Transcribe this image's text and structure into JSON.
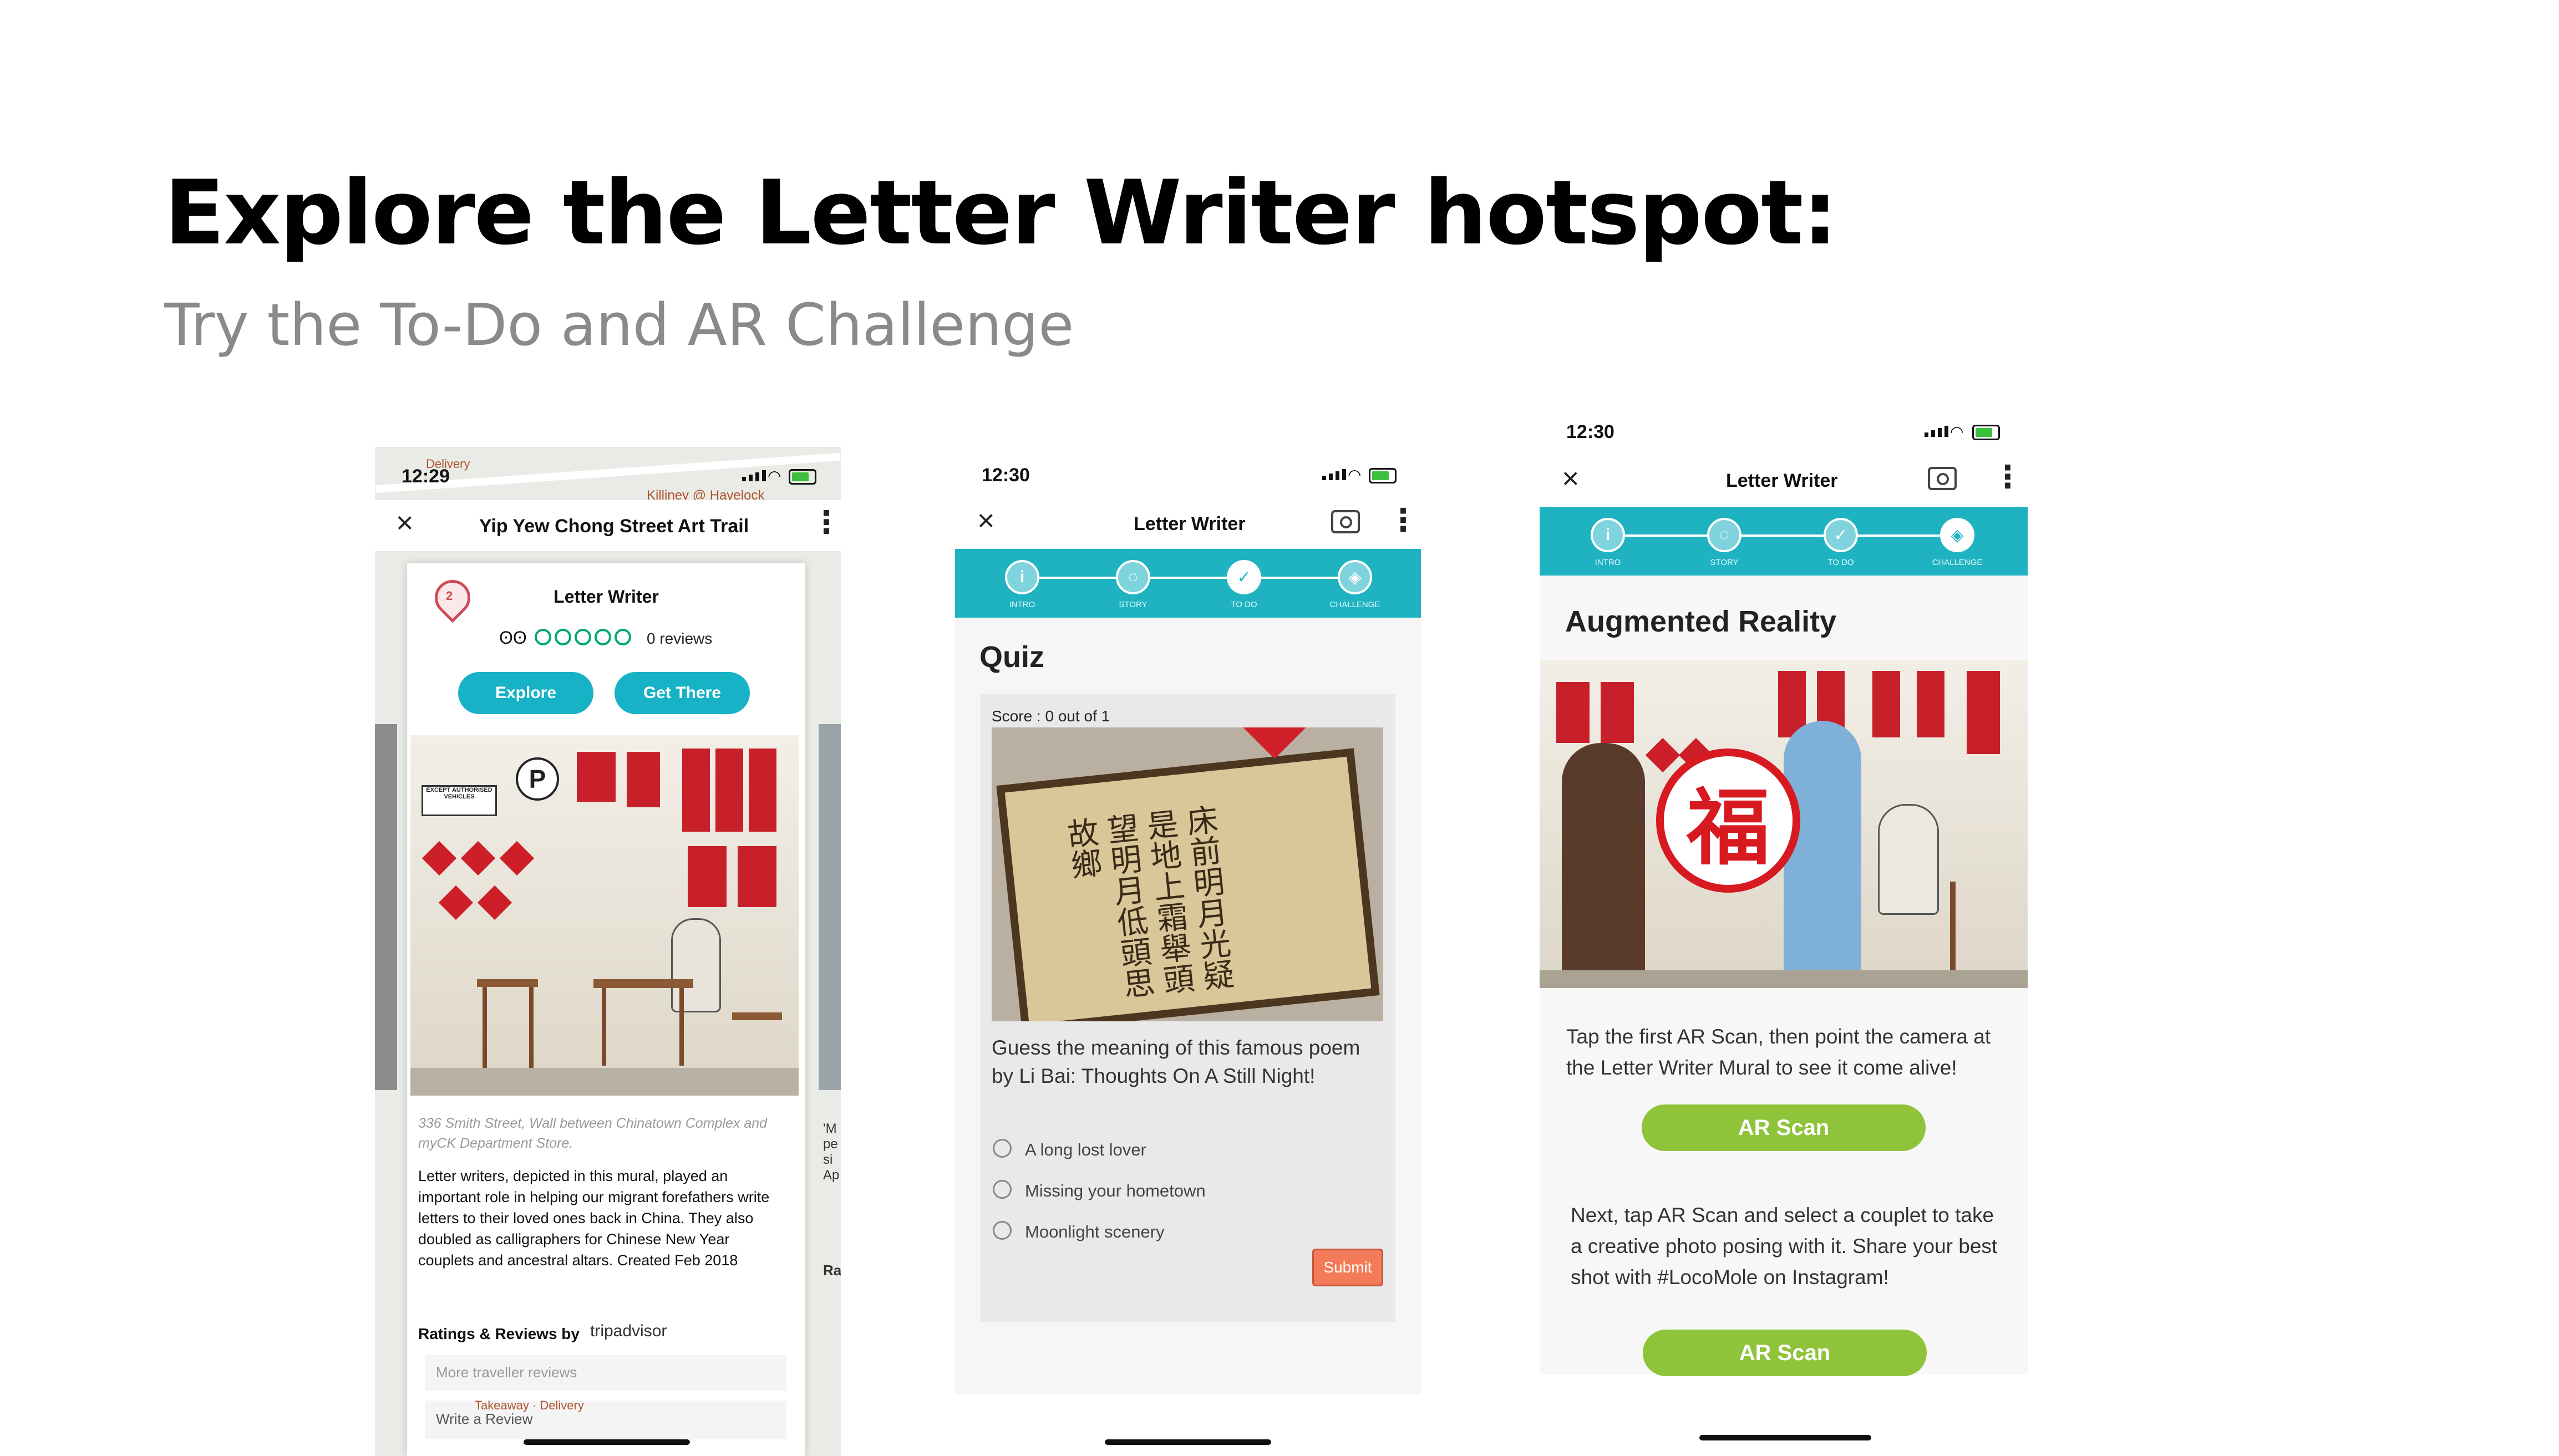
{
  "slide": {
    "title": "Explore the Letter Writer hotspot:",
    "subtitle": "Try the To-Do and AR Challenge"
  },
  "phone1": {
    "time": "12:29",
    "map_labels": [
      "Killiney @ Havelock",
      "Delivery",
      "Takeaway · Delivery"
    ],
    "trail_title": "Yip Yew Chong Street Art Trail",
    "pin_number": "2",
    "card_title": "Letter Writer",
    "reviews": "0 reviews",
    "explore_button": "Explore",
    "get_there_button": "Get There",
    "address": "336 Smith Street, Wall between Chinatown Complex and myCK Department Store.",
    "description": "Letter writers, depicted in this mural, played an important role in helping our migrant forefathers write letters to their loved ones back in China. They also doubled as calligraphers for Chinese New Year couplets and ancestral altars. Created Feb 2018",
    "ratings_label": "Ratings & Reviews by",
    "tripadvisor": "tripadvisor",
    "more_reviews": "More traveller reviews",
    "write_review": "Write a Review",
    "sign_text": "EXCEPT AUTHORISED VEHICLES",
    "peek_left": "'M pe si Ap",
    "peek_right": "Ra"
  },
  "phone2": {
    "time": "12:30",
    "app_title": "Letter Writer",
    "steps": [
      "INTRO",
      "STORY",
      "TO DO",
      "CHALLENGE"
    ],
    "quiz_title": "Quiz",
    "score": "Score : 0 out of 1",
    "question": "Guess the meaning of this famous poem by Li Bai: Thoughts On A Still Night!",
    "options": [
      "A long lost lover",
      "Missing your hometown",
      "Moonlight scenery"
    ],
    "submit": "Submit"
  },
  "phone3": {
    "time": "12:30",
    "app_title": "Letter Writer",
    "steps": [
      "INTRO",
      "STORY",
      "TO DO",
      "CHALLENGE"
    ],
    "section_title": "Augmented Reality",
    "instruction1": "Tap the first AR Scan, then point the camera at the Letter Writer Mural to see it come alive!",
    "ar_button1": "AR Scan",
    "instruction2": "Next, tap AR Scan and select a couplet to take a creative photo posing with it. Share your best shot with #LocoMole on Instagram!",
    "ar_button2": "AR Scan",
    "fu_char": "福"
  },
  "colors": {
    "teal": "#1fb3c2",
    "button_teal": "#17b2c6",
    "green": "#8fc33a",
    "submit": "#f47b5a",
    "tripadvisor_green": "#00aa6c"
  }
}
